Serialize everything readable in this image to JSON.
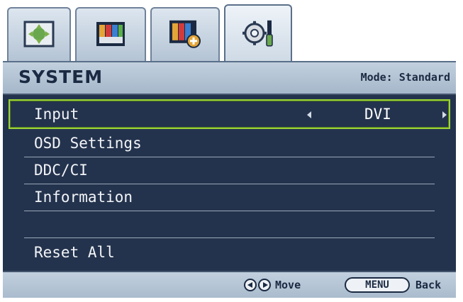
{
  "tabs": [
    {
      "icon": "picture-adjust-icon",
      "active": false
    },
    {
      "icon": "color-bars-icon",
      "active": false
    },
    {
      "icon": "picture-advanced-icon",
      "active": false
    },
    {
      "icon": "system-settings-icon",
      "active": true
    }
  ],
  "header": {
    "title": "SYSTEM",
    "mode": "Mode: Standard"
  },
  "menu": {
    "items": [
      {
        "label": "Input",
        "value": "DVI",
        "selected": true
      },
      {
        "label": "OSD Settings"
      },
      {
        "label": "DDC/CI"
      },
      {
        "label": "Information"
      },
      {
        "label": ""
      },
      {
        "label": "Reset All"
      }
    ]
  },
  "footer": {
    "move_label": "Move",
    "menu_key": "MENU",
    "back_label": "Back"
  },
  "colors": {
    "panel": "#24334d",
    "highlight": "#9cd23a",
    "header": "#b5c5d6"
  }
}
